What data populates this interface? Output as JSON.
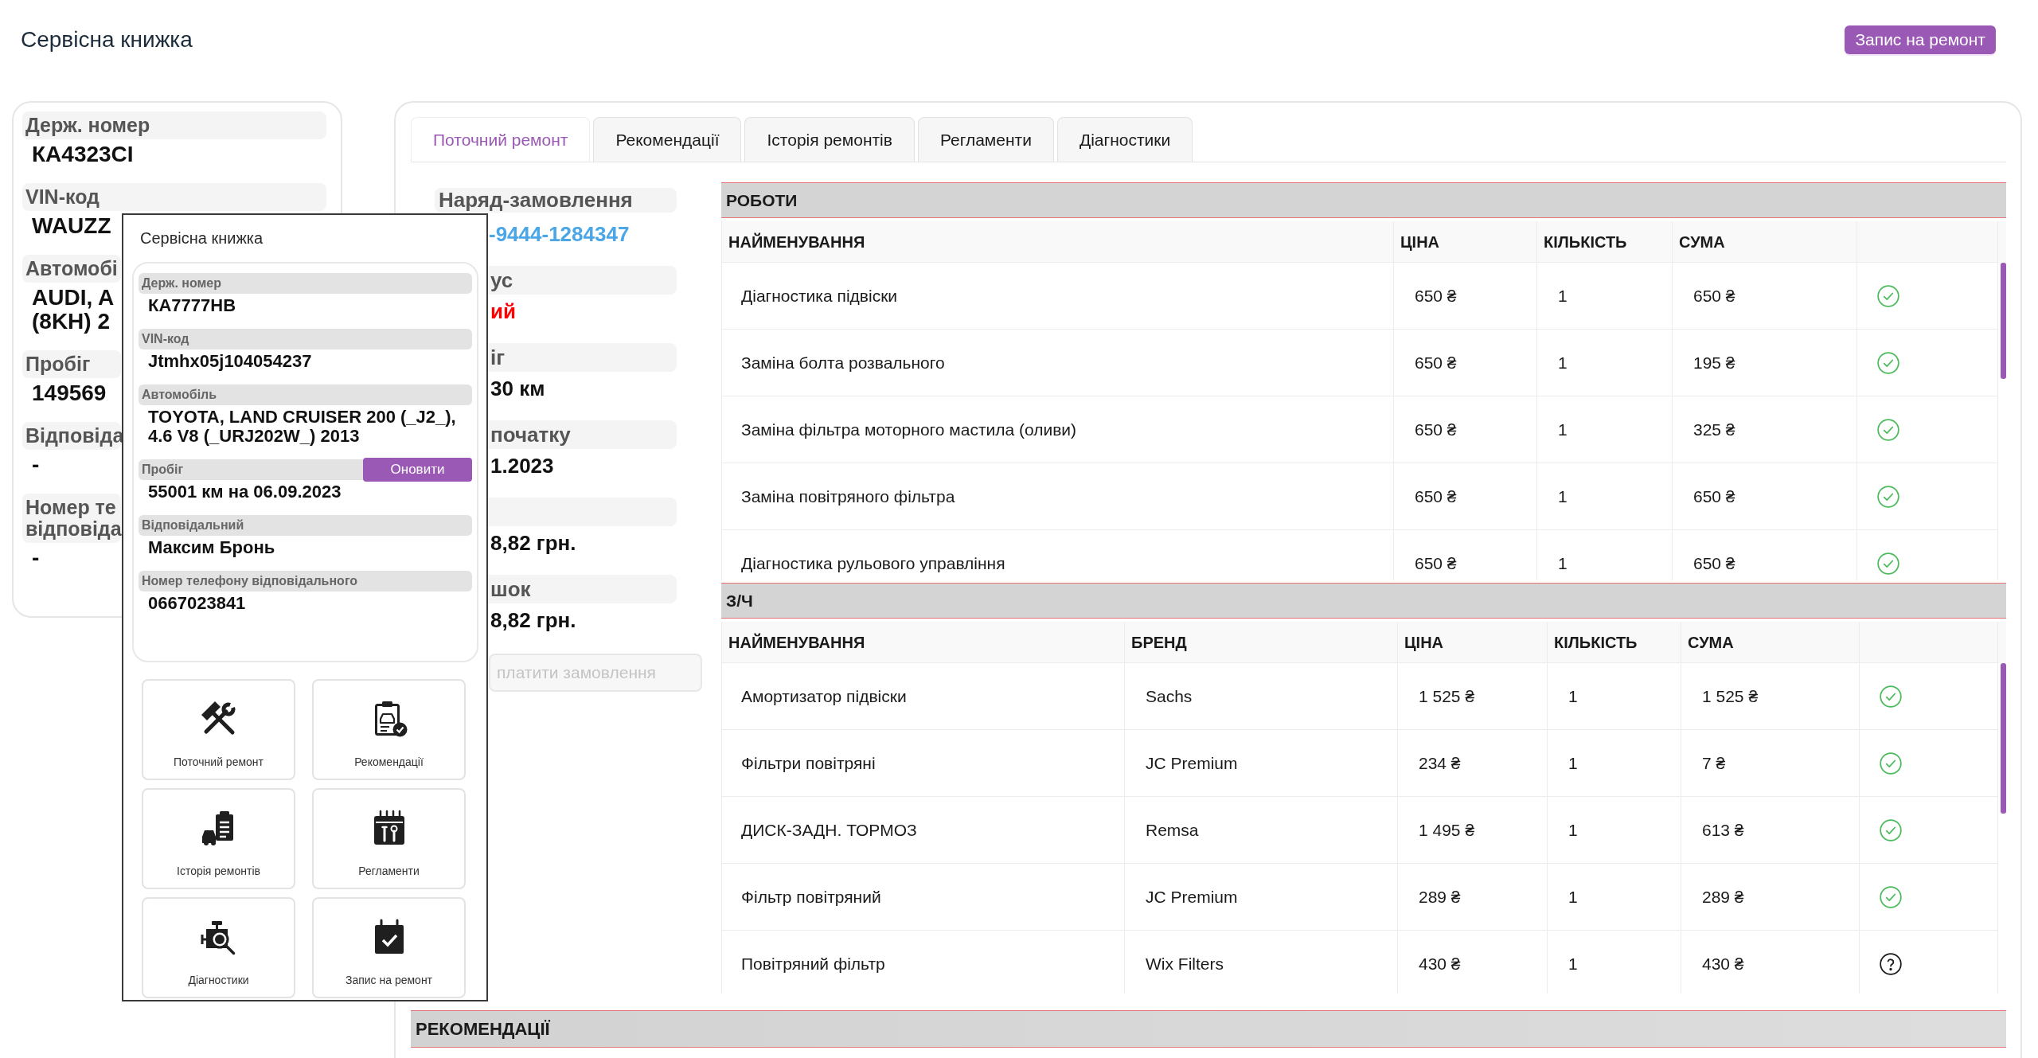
{
  "page": {
    "title": "Сервісна книжка",
    "book_button": "Запис на ремонт"
  },
  "vehicle_card": {
    "fields": [
      {
        "label_lines": [
          "Держ. номер"
        ],
        "value_lines": [
          "КА4323СІ"
        ]
      },
      {
        "label_lines": [
          "VIN-код"
        ],
        "value_lines": [
          "WAUZZ"
        ]
      },
      {
        "label_lines": [
          "Автомобі"
        ],
        "value_lines": [
          "AUDI, A",
          "(8KH) 2"
        ]
      },
      {
        "label_lines": [
          "Пробіг"
        ],
        "value_lines": [
          "149569"
        ]
      },
      {
        "label_lines": [
          "Відповіда"
        ],
        "value_lines": [
          "-"
        ]
      },
      {
        "label_lines": [
          "Номер те",
          "відповіда"
        ],
        "value_lines": [
          "-"
        ]
      }
    ]
  },
  "tabs": [
    {
      "label": "Поточний ремонт",
      "selected": true
    },
    {
      "label": "Рекомендації",
      "selected": false
    },
    {
      "label": "Історія ремонтів",
      "selected": false
    },
    {
      "label": "Регламенти",
      "selected": false
    },
    {
      "label": "Діагностики",
      "selected": false
    }
  ],
  "order": {
    "title": "Наряд-замовлення",
    "number": "-9444-1284347",
    "fields": [
      {
        "label": "ус",
        "value": "ий",
        "kind": "status"
      },
      {
        "label": "іг",
        "value": "30 км",
        "kind": "text"
      },
      {
        "label": "початку",
        "value": "1.2023",
        "kind": "text"
      },
      {
        "value": "8,82 грн.",
        "kind": "text"
      },
      {
        "label": "шок",
        "value": "8,82 грн.",
        "kind": "text"
      }
    ],
    "pay_button": {
      "label": "платити замовлення",
      "disabled": true
    }
  },
  "works": {
    "title": "РОБОТИ",
    "columns": [
      "НАЙМЕНУВАННЯ",
      "ЦІНА",
      "КІЛЬКІСТЬ",
      "СУМА"
    ],
    "rows": [
      {
        "name": "Діагностика підвіски",
        "price": "650 ₴",
        "quantity": "1",
        "sum": "650 ₴",
        "confirmed": true
      },
      {
        "name": "Заміна болта розвального",
        "price": "650 ₴",
        "quantity": "1",
        "sum": "195 ₴",
        "confirmed": true
      },
      {
        "name": "Заміна фільтра моторного мастила (оливи)",
        "price": "650 ₴",
        "quantity": "1",
        "sum": "325 ₴",
        "confirmed": true
      },
      {
        "name": "Заміна повітряного фільтра",
        "price": "650 ₴",
        "quantity": "1",
        "sum": "650 ₴",
        "confirmed": true
      },
      {
        "name": "Діагностика рульового управління",
        "price": "650 ₴",
        "quantity": "1",
        "sum": "650 ₴",
        "confirmed": true
      }
    ]
  },
  "parts": {
    "title": "З/Ч",
    "columns": [
      "НАЙМЕНУВАННЯ",
      "БРЕНД",
      "ЦІНА",
      "КІЛЬКІСТЬ",
      "СУМА"
    ],
    "rows": [
      {
        "name": "Амортизатор підвіски",
        "brand": "Sachs",
        "price": "1 525 ₴",
        "quantity": "1",
        "sum": "1 525 ₴",
        "confirmed": true
      },
      {
        "name": "Фільтри повітряні",
        "brand": "JC Premium",
        "price": "234 ₴",
        "quantity": "1",
        "sum": "7 ₴",
        "confirmed": true
      },
      {
        "name": "ДИСК-ЗАДН. ТОРМОЗ",
        "brand": "Remsa",
        "price": "1 495 ₴",
        "quantity": "1",
        "sum": "613 ₴",
        "confirmed": true
      },
      {
        "name": "Фільтр повітряний",
        "brand": "JC Premium",
        "price": "289 ₴",
        "quantity": "1",
        "sum": "289 ₴",
        "confirmed": true
      },
      {
        "name": "Повітряний фільтр",
        "brand": "Wix Filters",
        "price": "430 ₴",
        "quantity": "1",
        "sum": "430 ₴",
        "confirmed": false
      }
    ]
  },
  "recommendations": {
    "title": "РЕКОМЕНДАЦІЇ"
  },
  "service_book_window": {
    "title": "Сервісна книжка",
    "fields": [
      {
        "label": "Держ. номер",
        "value": "КА7777НВ"
      },
      {
        "label": "VIN-код",
        "value": "Jtmhx05j104054237"
      },
      {
        "label": "Автомобіль",
        "value": "TOYOTA, LAND CRUISER 200 (_J2_), 4.6 V8 (_URJ202W_) 2013"
      },
      {
        "label": "Пробіг",
        "value": "55001 км на 06.09.2023",
        "action": "Оновити"
      },
      {
        "label": "Відповідальний",
        "value": "Максим Бронь"
      },
      {
        "label": "Номер телефону відповідального",
        "value": "0667023841"
      }
    ],
    "tiles": [
      {
        "label": "Поточний ремонт"
      },
      {
        "label": "Рекомендації"
      },
      {
        "label": "Історія ремонтів"
      },
      {
        "label": "Регламенти"
      },
      {
        "label": "Діагностики"
      },
      {
        "label": "Запис на ремонт"
      }
    ]
  }
}
